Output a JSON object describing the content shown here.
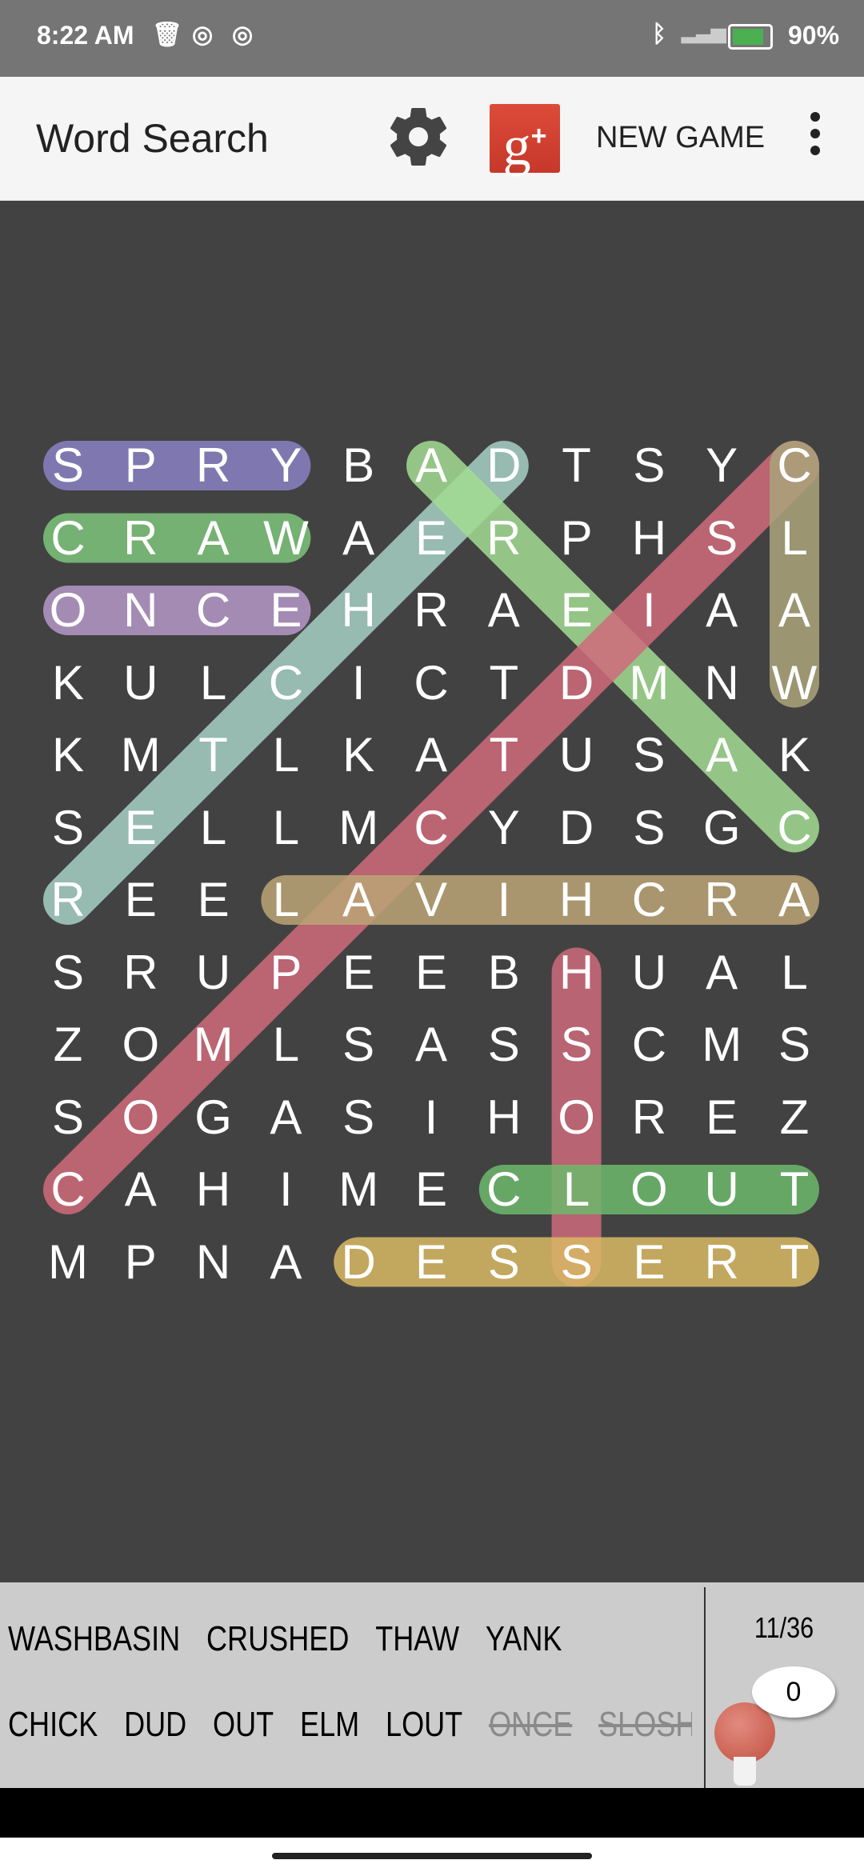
{
  "status_bar": {
    "time": "8:22 AM",
    "battery": "90%",
    "icons": [
      "trash-icon",
      "q-app-icon",
      "q-app-icon",
      "bluetooth-icon",
      "signal-icon",
      "battery-charging-icon"
    ]
  },
  "app_bar": {
    "title": "Word Search",
    "new_game_label": "NEW GAME",
    "icons": [
      "gear-icon",
      "google-plus-icon",
      "more-vert-icon"
    ]
  },
  "grid": {
    "rows": [
      "SPRYBADTSYC",
      "CRAWAERPHSL",
      "ONCEHRAEIAA",
      "KULCICTDMNW",
      "KMTLKATUSAK",
      "SELLMCYDSGC",
      "REELAVIHCRA",
      "SRUPEEBHUAL",
      "ZOMLSASSCMS",
      "SOGASIHOREZ",
      "CAHIMECLOUT",
      "MPNADESSERT"
    ],
    "highlights": [
      {
        "start": [
          0,
          0
        ],
        "end": [
          0,
          3
        ],
        "color": "#8a80c2"
      },
      {
        "start": [
          1,
          0
        ],
        "end": [
          1,
          3
        ],
        "color": "#7cc47a"
      },
      {
        "start": [
          2,
          0
        ],
        "end": [
          2,
          3
        ],
        "color": "#b598c8"
      },
      {
        "start": [
          6,
          0
        ],
        "end": [
          0,
          6
        ],
        "color": "#a6cfc4"
      },
      {
        "start": [
          0,
          5
        ],
        "end": [
          5,
          10
        ],
        "color": "#a2dc92"
      },
      {
        "start": [
          0,
          10
        ],
        "end": [
          10,
          0
        ],
        "color": "#d06a7a"
      },
      {
        "start": [
          0,
          10
        ],
        "end": [
          3,
          10
        ],
        "color": "#aaa37a"
      },
      {
        "start": [
          6,
          3
        ],
        "end": [
          6,
          10
        ],
        "color": "#bba476"
      },
      {
        "start": [
          7,
          7
        ],
        "end": [
          11,
          7
        ],
        "color": "#cc6a7a"
      },
      {
        "start": [
          10,
          6
        ],
        "end": [
          10,
          10
        ],
        "color": "#6cb86c"
      },
      {
        "start": [
          11,
          4
        ],
        "end": [
          11,
          10
        ],
        "color": "#d8b964"
      }
    ]
  },
  "word_list": {
    "rows": [
      [
        {
          "text": "WASHBASIN",
          "found": false
        },
        {
          "text": "CRUSHED",
          "found": false
        },
        {
          "text": "THAW",
          "found": false
        },
        {
          "text": "YANK",
          "found": false
        }
      ],
      [
        {
          "text": "CHICK",
          "found": false
        },
        {
          "text": "DUD",
          "found": false
        },
        {
          "text": "OUT",
          "found": false
        },
        {
          "text": "ELM",
          "found": false
        },
        {
          "text": "LOUT",
          "found": false
        },
        {
          "text": "ONCE",
          "found": true
        },
        {
          "text": "SLOSH",
          "found": true
        }
      ]
    ]
  },
  "progress": {
    "text": "11/36",
    "found": 11,
    "total": 36
  },
  "hints": {
    "count": "0",
    "icon": "lightbulb-icon"
  }
}
